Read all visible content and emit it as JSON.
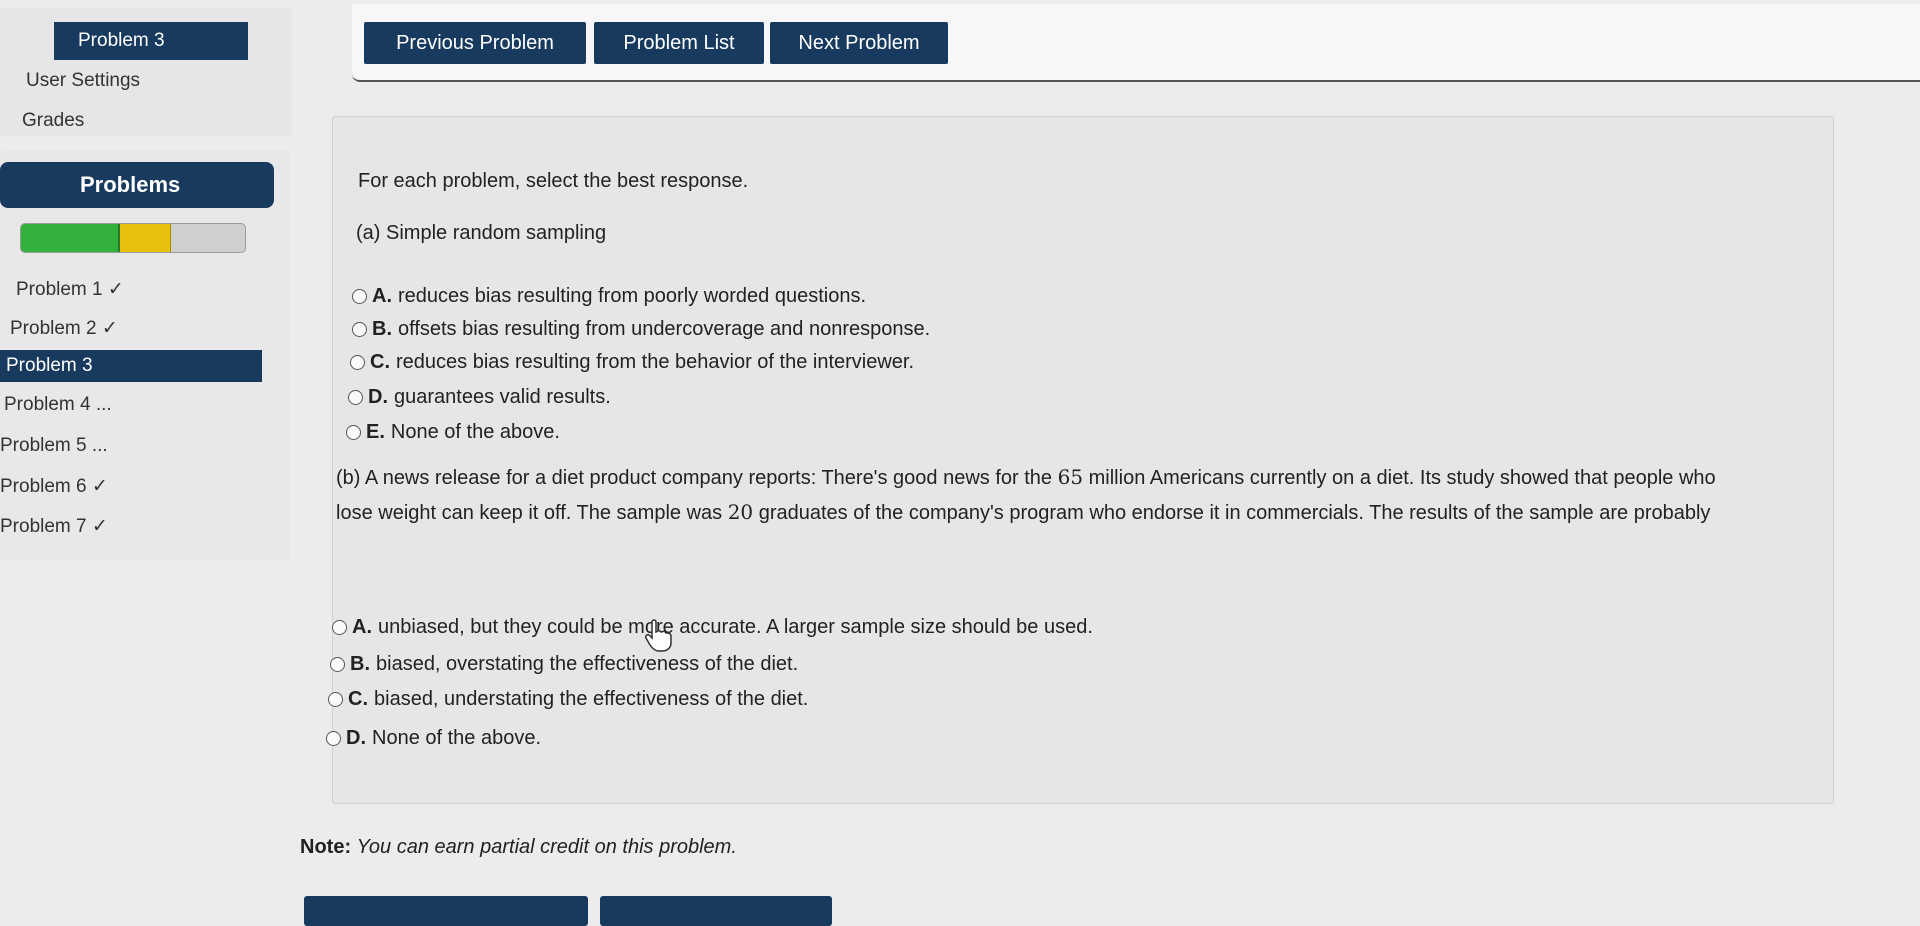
{
  "sidebar": {
    "current_problem": "Problem 3",
    "links": [
      "User Settings",
      "Grades"
    ],
    "problems_heading": "Problems",
    "progress": {
      "correct_fraction": 0.44,
      "partial_fraction": 0.23,
      "colors": {
        "correct": "#33b13d",
        "partial": "#e6c20f",
        "empty": "#cfcfcf"
      }
    },
    "problem_list": [
      {
        "label": "Problem 1 ✓",
        "status": "correct"
      },
      {
        "label": "Problem 2 ✓",
        "status": "correct"
      },
      {
        "label": "Problem 3",
        "status": "current"
      },
      {
        "label": "Problem 4 ...",
        "status": "unattempted"
      },
      {
        "label": "Problem 5 ...",
        "status": "unattempted"
      },
      {
        "label": "Problem 6 ✓",
        "status": "correct"
      },
      {
        "label": "Problem 7 ✓",
        "status": "correct"
      }
    ]
  },
  "nav": {
    "previous": "Previous Problem",
    "list": "Problem List",
    "next": "Next Problem"
  },
  "problem": {
    "instructions": "For each problem, select the best response.",
    "part_a": {
      "prompt": "(a) Simple random sampling",
      "options": [
        {
          "letter": "A.",
          "text": "reduces bias resulting from poorly worded questions."
        },
        {
          "letter": "B.",
          "text": "offsets bias resulting from undercoverage and nonresponse."
        },
        {
          "letter": "C.",
          "text": "reduces bias resulting from the behavior of the interviewer."
        },
        {
          "letter": "D.",
          "text": "guarantees valid results."
        },
        {
          "letter": "E.",
          "text": "None of the above."
        }
      ]
    },
    "part_b": {
      "prompt_1": "(b) A news release for a diet product company reports: There's good news for the ",
      "num_1": "65",
      "prompt_2": " million Americans currently on a diet. Its study showed that people who lose weight can keep it off. The sample was ",
      "num_2": "20",
      "prompt_3": " graduates of the company's program who endorse it in commercials. The results of the sample are probably",
      "options": [
        {
          "letter": "A.",
          "text": "unbiased, but they could be more accurate. A larger sample size should be used."
        },
        {
          "letter": "B.",
          "text": "biased, overstating the effectiveness of the diet."
        },
        {
          "letter": "C.",
          "text": "biased, understating the effectiveness of the diet."
        },
        {
          "letter": "D.",
          "text": "None of the above."
        }
      ]
    },
    "note_label": "Note:",
    "note_text": "You can earn partial credit on this problem."
  },
  "theme": {
    "nav_color": "#173a5e",
    "background": "#ececec"
  }
}
